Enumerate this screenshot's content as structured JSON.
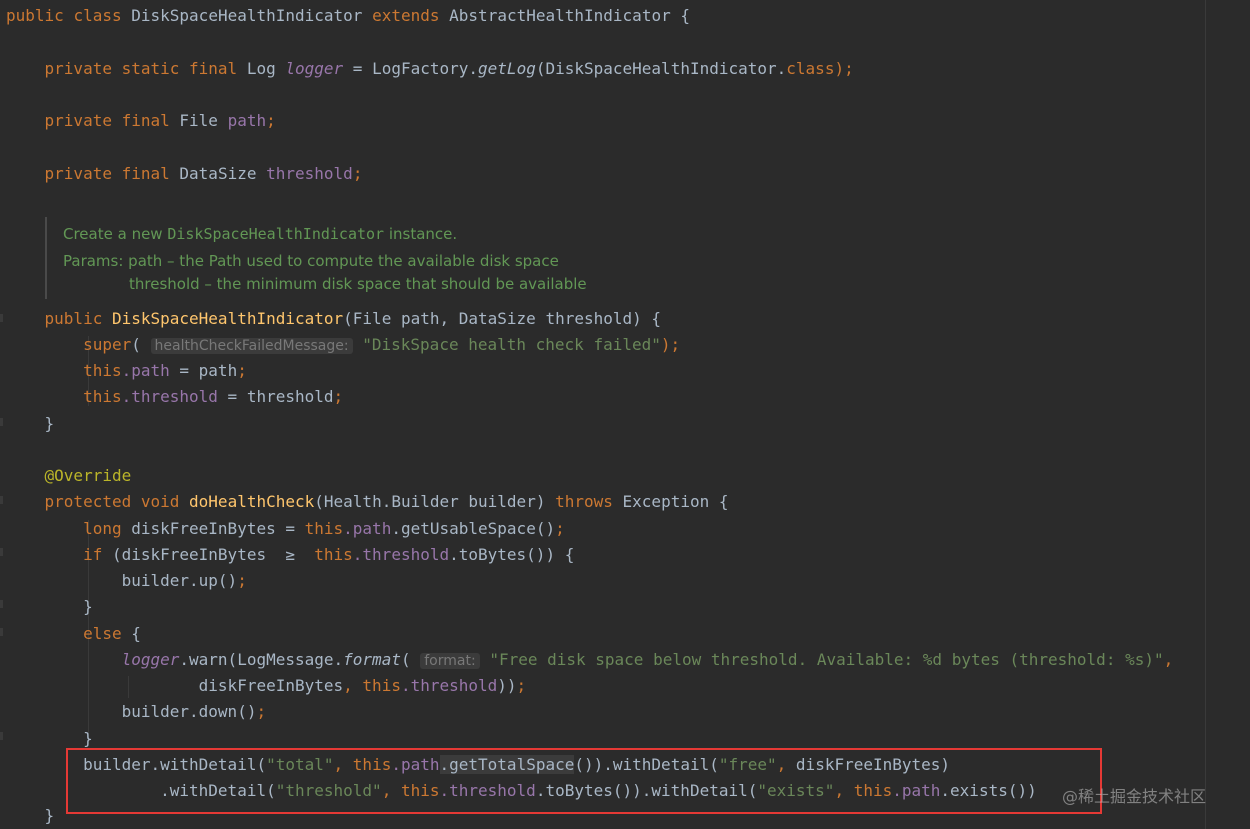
{
  "code": {
    "l1_public": "public",
    "l1_class": "class",
    "l1_name": "DiskSpaceHealthIndicator",
    "l1_extends": "extends",
    "l1_parent": "AbstractHealthIndicator {",
    "l2_mods": "private static final",
    "l2_type": "Log",
    "l2_field": "logger",
    "l2_eq": " = LogFactory.",
    "l2_method": "getLog",
    "l2_arg": "(DiskSpaceHealthIndicator.",
    "l2_class": "class",
    "l2_end": ");",
    "l3_mods": "private final",
    "l3_type": "File",
    "l3_field": "path",
    "l3_semi": ";",
    "l4_mods": "private final",
    "l4_type": "DataSize",
    "l4_field": "threshold",
    "l4_semi": ";",
    "l5_public": "public",
    "l5_name": "DiskSpaceHealthIndicator",
    "l5_params": "(File path, DataSize threshold) {",
    "l6_super": "super",
    "l6_paren": "(",
    "l6_hint": "healthCheckFailedMessage:",
    "l6_str": "\"DiskSpace health check failed\"",
    "l6_end": ");",
    "l7_this": "this",
    "l7_field": ".path",
    "l7_rest": " = path",
    "l7_semi": ";",
    "l8_this": "this",
    "l8_field": ".threshold",
    "l8_rest": " = threshold",
    "l8_semi": ";",
    "l9_brace": "}",
    "l10_ann": "@Override",
    "l11_prot": "protected void",
    "l11_name": "doHealthCheck",
    "l11_params": "(Health.Builder builder)",
    "l11_throws": "throws",
    "l11_exc": "Exception {",
    "l12_type": "long",
    "l12_var": " diskFreeInBytes = ",
    "l12_this": "this",
    "l12_field": ".path",
    "l12_call": ".getUsableSpace()",
    "l12_semi": ";",
    "l13_if": "if",
    "l13_cond": " (diskFreeInBytes  ≥  ",
    "l13_this": "this",
    "l13_field": ".threshold",
    "l13_call": ".toBytes()) {",
    "l14_call": "builder.up()",
    "l14_semi": ";",
    "l15_brace": "}",
    "l16_else": "else",
    "l16_brace": " {",
    "l17_logger": "logger",
    "l17_warn": ".warn(LogMessage.",
    "l17_format": "format",
    "l17_paren": "(",
    "l17_hint": "format:",
    "l17_str": "\"Free disk space below threshold. Available: %d bytes (threshold: %s)\"",
    "l17_comma": ",",
    "l18_var": "diskFreeInBytes",
    "l18_comma": ", ",
    "l18_this": "this",
    "l18_field": ".threshold",
    "l18_end": "))",
    "l18_semi": ";",
    "l19_call": "builder.down()",
    "l19_semi": ";",
    "l20_brace": "}",
    "l21_a": "builder.withDetail(",
    "l21_str1": "\"total\"",
    "l21_comma1": ", ",
    "l21_this": "this",
    "l21_field": ".path",
    "l21_call": ".getTotalSpace",
    "l21_b": "()).withDetail(",
    "l21_str2": "\"free\"",
    "l21_comma2": ", ",
    "l21_c": "diskFreeInBytes)",
    "l22_a": ".withDetail(",
    "l22_str1": "\"threshold\"",
    "l22_comma1": ", ",
    "l22_this": "this",
    "l22_field": ".threshold",
    "l22_b": ".toBytes()).withDetail(",
    "l22_str2": "\"exists\"",
    "l22_comma2": ", ",
    "l22_this2": "this",
    "l22_field2": ".path",
    "l22_c": ".exists())",
    "l23_brace": "}"
  },
  "javadoc": {
    "line1_a": "Create a new ",
    "line1_code": "DiskSpaceHealthIndicator",
    "line1_b": " instance.",
    "line2": "Params: path – the Path used to compute the available disk space",
    "line3": "threshold – the minimum disk space that should be available"
  },
  "watermark": "@稀土掘金技术社区",
  "colors": {
    "background": "#2b2b2b",
    "keyword": "#cc7832",
    "method_decl": "#ffc66d",
    "field": "#9876aa",
    "string": "#6a8759",
    "annotation": "#bbb529",
    "javadoc": "#629755",
    "highlight_box": "#e53935"
  }
}
